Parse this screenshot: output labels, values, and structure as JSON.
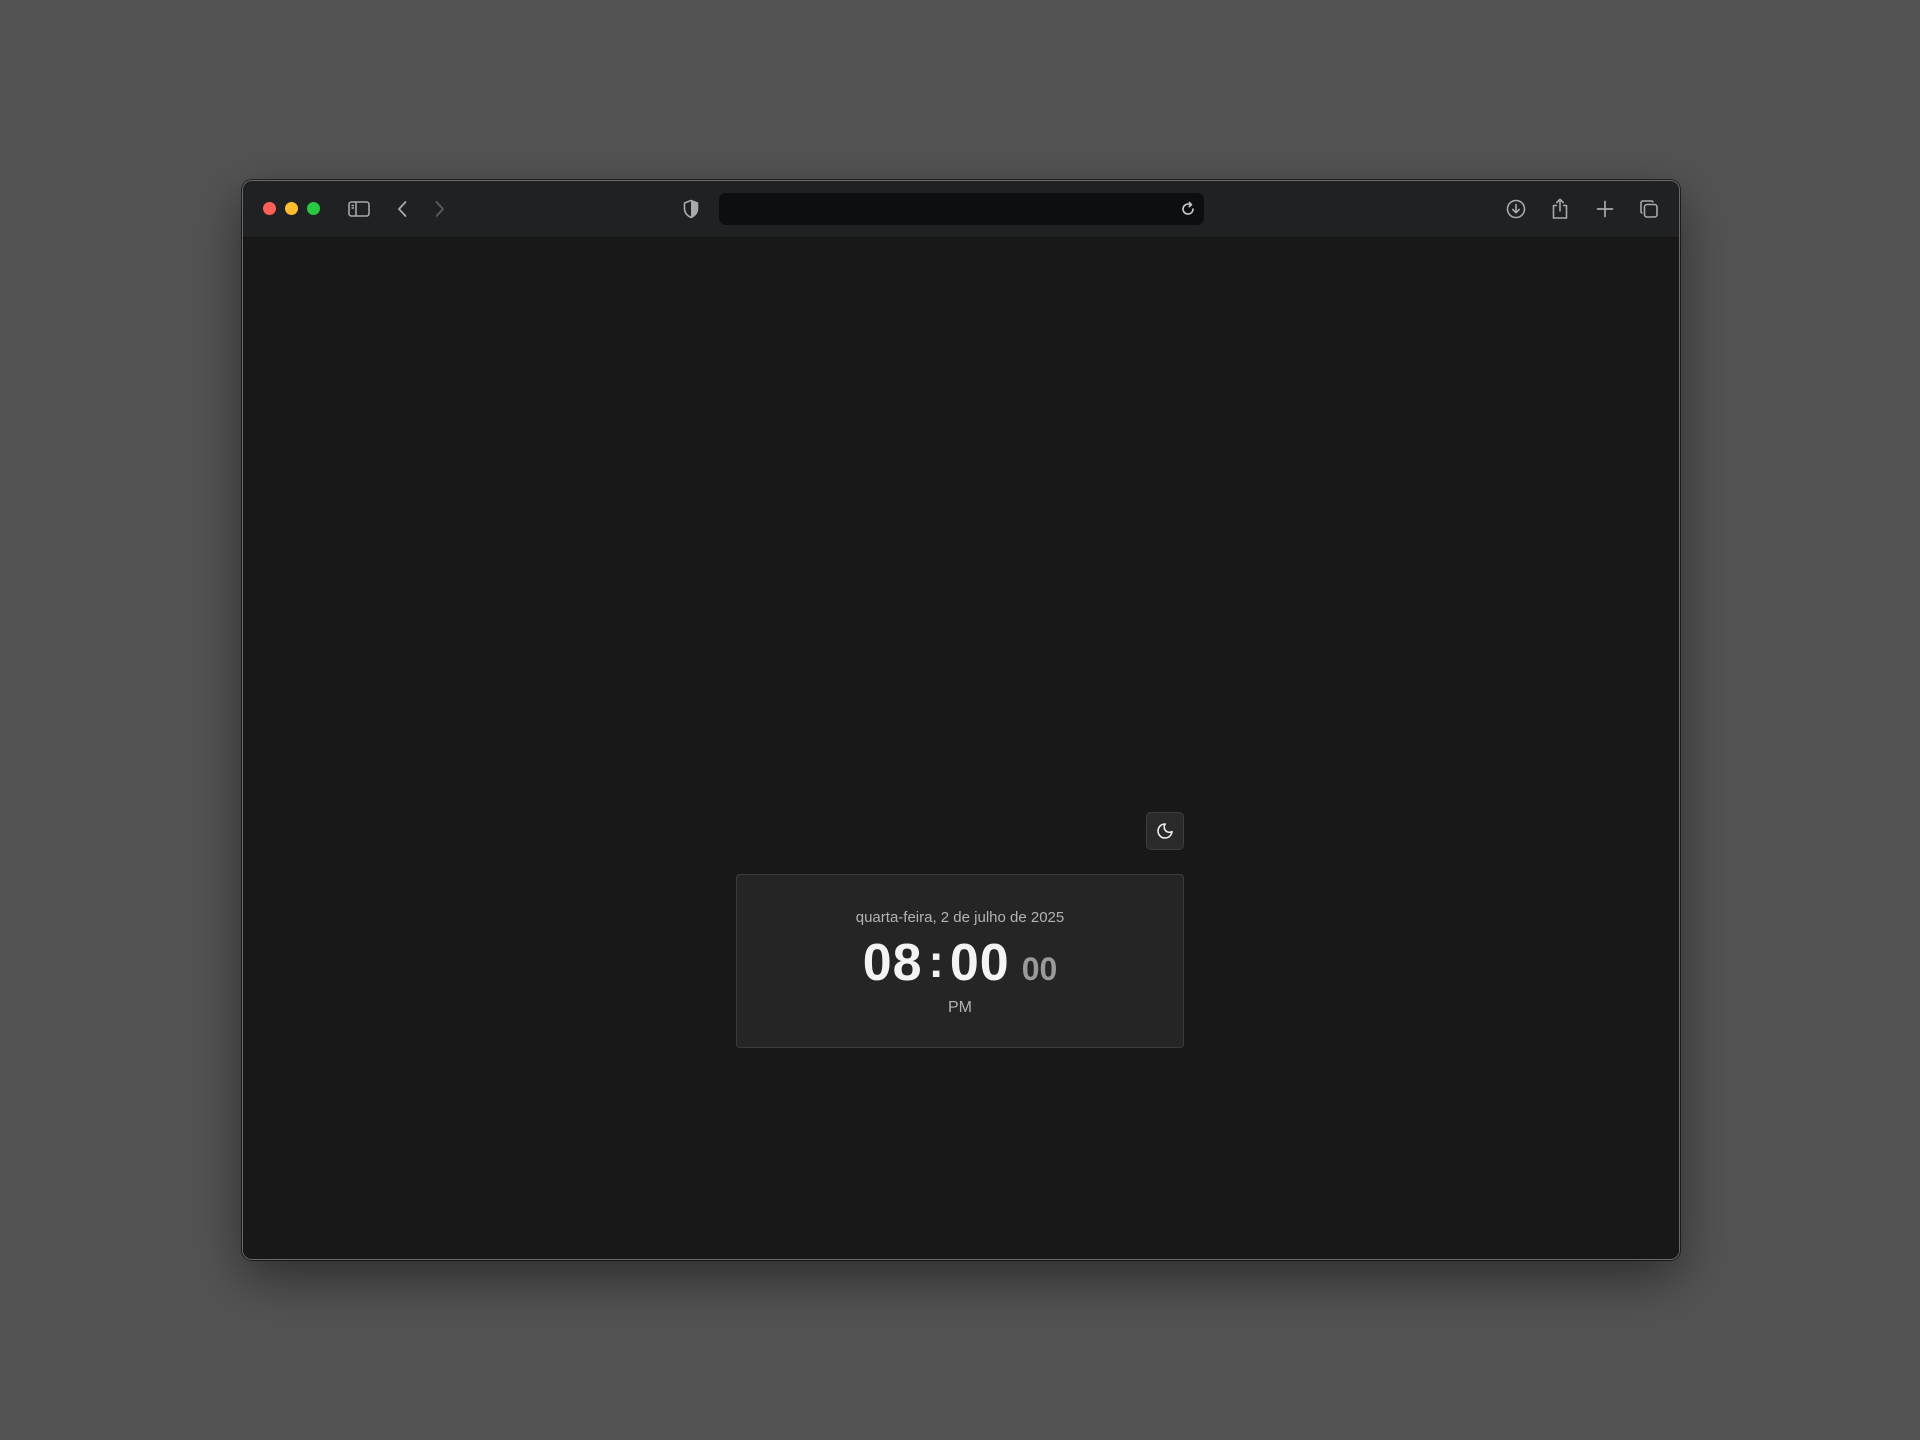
{
  "window": {
    "traffic_lights": {
      "close_color": "#ff5f57",
      "minimize_color": "#febc2e",
      "zoom_color": "#28c840"
    }
  },
  "toolbar": {
    "icons": {
      "sidebar": "sidebar-icon",
      "back": "chevron-left-icon",
      "forward": "chevron-right-icon",
      "privacy": "shield-icon",
      "reload": "reload-icon",
      "download": "download-icon",
      "share": "share-icon",
      "new_tab": "plus-icon",
      "tabs_overview": "tabs-overview-icon"
    },
    "address_bar": {
      "value": ""
    }
  },
  "theme_toggle": {
    "icon": "moon-icon"
  },
  "clock": {
    "date": "quarta-feira, 2 de julho de 2025",
    "hours": "08",
    "separator": ":",
    "minutes": "00",
    "seconds": "00",
    "period": "PM"
  },
  "colors": {
    "desktop_background": "#535353",
    "page_background": "#181818",
    "card_background": "#252525",
    "toolbar_background": "#1f2123"
  }
}
